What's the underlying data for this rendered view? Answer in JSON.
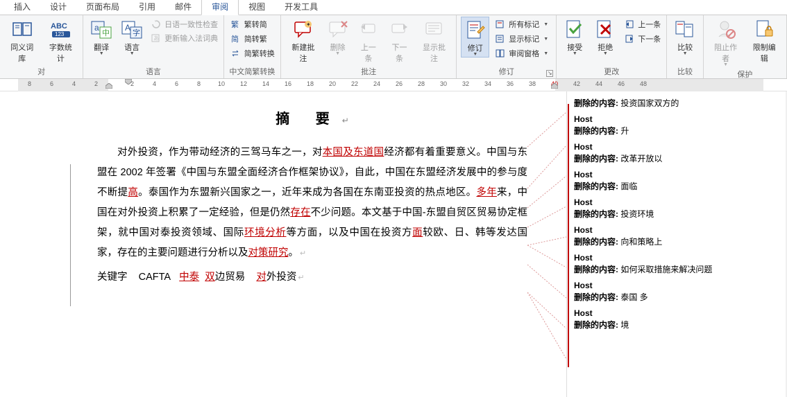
{
  "tabs": [
    "插入",
    "设计",
    "页面布局",
    "引用",
    "邮件",
    "审阅",
    "视图",
    "开发工具"
  ],
  "active_tab": "审阅",
  "ribbon": {
    "g_proof": {
      "label": "对",
      "thesaurus": "同义词库",
      "wordcount": "字数统计"
    },
    "g_lang": {
      "label": "语言",
      "translate": "翻译",
      "language": "语言",
      "jp_check": "日语一致性检查",
      "ime_update": "更新输入法词典"
    },
    "g_cn": {
      "label": "中文简繁转换",
      "t2s": "繁转简",
      "s2t": "简转繁",
      "conv": "简繁转换"
    },
    "g_comments": {
      "label": "批注",
      "new": "新建批注",
      "delete": "删除",
      "prev": "上一条",
      "next": "下一条",
      "show": "显示批注"
    },
    "g_track": {
      "label": "修订",
      "track": "修订",
      "all_markup": "所有标记",
      "show_markup": "显示标记",
      "review_pane": "审阅窗格"
    },
    "g_changes": {
      "label": "更改",
      "accept": "接受",
      "reject": "拒绝",
      "prev": "上一条",
      "next": "下一条"
    },
    "g_compare": {
      "label": "比较",
      "compare": "比较"
    },
    "g_protect": {
      "label": "保护",
      "block": "阻止作者",
      "restrict": "限制编辑"
    }
  },
  "ruler": {
    "left_nums": [
      "8",
      "6",
      "4",
      "2"
    ],
    "right_nums": [
      "2",
      "4",
      "6",
      "8",
      "10",
      "12",
      "14",
      "16",
      "18",
      "20",
      "22",
      "24",
      "26",
      "28",
      "30",
      "32",
      "34",
      "36",
      "38",
      "40",
      "42",
      "44",
      "46",
      "48"
    ]
  },
  "doc": {
    "title": "摘  要",
    "p1": {
      "t1": "对外投资，作为带动经济的三驾马车之一，对",
      "i1": "本国及东道国",
      "t2": "经济都有着重要意义。中国与东盟在 2002 年签署《中国与东盟全面经济合作框架协议》，自此，中国在东盟经济发展中的参与度不断提",
      "i2": "高",
      "t3": "。泰国作为东盟新兴国家之一，近年来成为各国在东南亚投资的热点地区。",
      "i3": "多年",
      "t4": "来，中国在对外投资上积累了一定经验，但是仍然",
      "i4": "存在",
      "t5": "不少问题。本文基于中国-东盟自贸区贸易协定框架，就中国对泰投资领域、国际",
      "i5": "环境分析",
      "t6": "等方面，以及中国在投资方",
      "i5b": "面",
      "t7": "较欧、日、韩等发达国家，存在的主要问题进行分析以及",
      "i6": "对策研究",
      "t8": "。"
    },
    "kw": {
      "label": "关键字",
      "k1": "CAFTA",
      "k2a": "中泰",
      "k2b": "双",
      "k2c": "边贸易",
      "k3a": "对",
      "k3b": "外投资"
    }
  },
  "markup": {
    "host": "Host",
    "del_label": "删除的内容:",
    "items": [
      "投资国家双方的",
      "升",
      "改革开放以",
      "面临",
      "投资环境",
      "向和策略上",
      "如何采取措施来解决问题",
      "泰国    多",
      "境"
    ]
  }
}
